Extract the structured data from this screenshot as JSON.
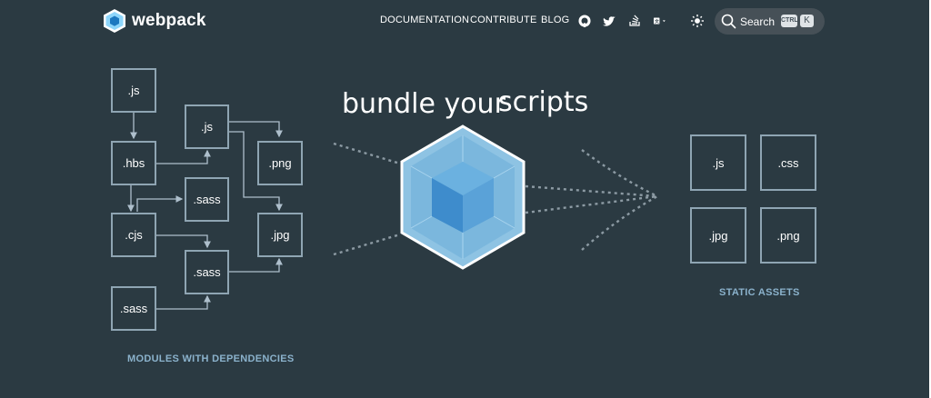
{
  "brand": {
    "name": "webpack"
  },
  "nav": {
    "links": [
      "DOCUMENTATION",
      "CONTRIBUTE",
      "BLOG"
    ],
    "icons": [
      "github-icon",
      "twitter-icon",
      "stackoverflow-icon",
      "language-icon",
      "theme-toggle-icon"
    ]
  },
  "search": {
    "label": "Search",
    "key1": "CTRL",
    "key2": "K"
  },
  "hero": {
    "headline1": "bundle your",
    "headline2": "scripts"
  },
  "modules": {
    "label": "MODULES WITH DEPENDENCIES",
    "items": [
      ".js",
      ".hbs",
      ".cjs",
      ".sass",
      ".js",
      ".sass",
      ".sass",
      ".png",
      ".jpg"
    ]
  },
  "assets": {
    "label": "STATIC ASSETS",
    "items": [
      ".js",
      ".css",
      ".jpg",
      ".png"
    ]
  },
  "colors": {
    "background": "#2b3a42",
    "accent": "#8dd6f9",
    "cube_dark": "#465e69"
  }
}
